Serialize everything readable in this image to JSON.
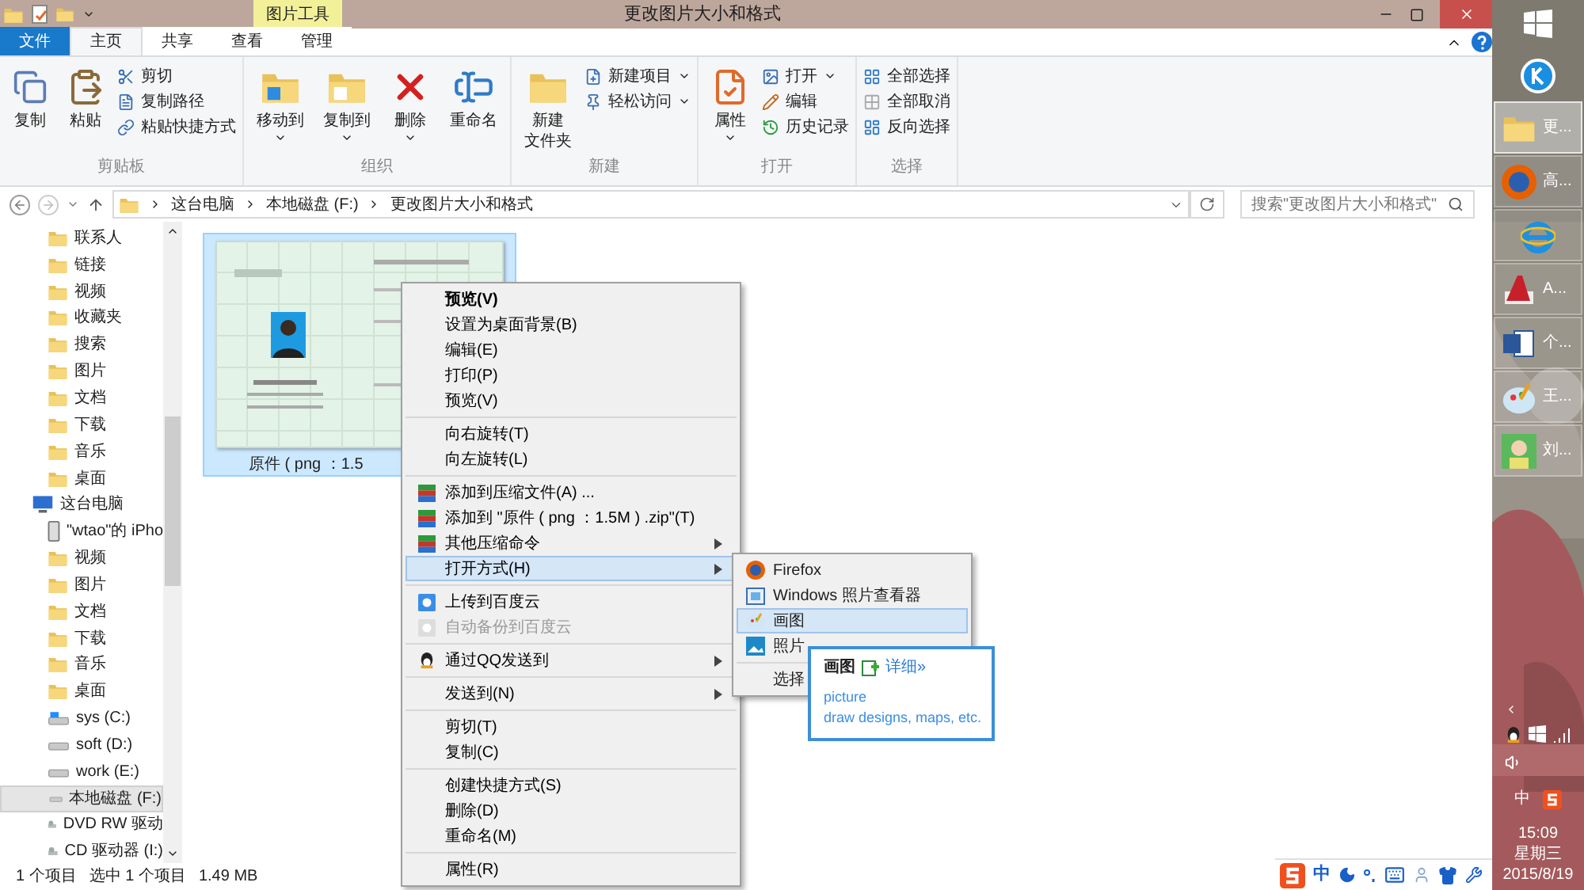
{
  "title_bar": {
    "context_tab": "图片工具",
    "title": "更改图片大小和格式"
  },
  "ribbon_tabs": [
    {
      "label": "文件",
      "kind": "file",
      "selected": false
    },
    {
      "label": "主页",
      "kind": "tab",
      "selected": true
    },
    {
      "label": "共享",
      "kind": "tab",
      "selected": false
    },
    {
      "label": "查看",
      "kind": "tab",
      "selected": false
    },
    {
      "label": "管理",
      "kind": "context",
      "selected": false
    }
  ],
  "ribbon_groups": [
    {
      "label": "剪贴板",
      "commands": [
        {
          "lines": [
            "复制"
          ],
          "kind": "large",
          "dropdown": false
        },
        {
          "lines": [
            "粘贴"
          ],
          "kind": "large",
          "dropdown": false
        },
        {
          "lines": [
            "剪切"
          ],
          "kind": "small",
          "dropdown": false
        },
        {
          "lines": [
            "复制路径"
          ],
          "kind": "small",
          "dropdown": false
        },
        {
          "lines": [
            "粘贴快捷方式"
          ],
          "kind": "small",
          "dropdown": false
        }
      ]
    },
    {
      "label": "组织",
      "commands": [
        {
          "lines": [
            "移动到"
          ],
          "kind": "large",
          "dropdown": true
        },
        {
          "lines": [
            "复制到"
          ],
          "kind": "large",
          "dropdown": true
        },
        {
          "lines": [
            "删除"
          ],
          "kind": "large",
          "dropdown": true
        },
        {
          "lines": [
            "重命名"
          ],
          "kind": "large",
          "dropdown": false
        }
      ]
    },
    {
      "label": "新建",
      "commands": [
        {
          "lines": [
            "新建",
            "文件夹"
          ],
          "kind": "large",
          "dropdown": false
        },
        {
          "lines": [
            "新建项目"
          ],
          "kind": "small",
          "dropdown": true
        },
        {
          "lines": [
            "轻松访问"
          ],
          "kind": "small",
          "dropdown": true
        }
      ]
    },
    {
      "label": "打开",
      "commands": [
        {
          "lines": [
            "属性"
          ],
          "kind": "large",
          "dropdown": true
        },
        {
          "lines": [
            "打开"
          ],
          "kind": "small",
          "dropdown": true
        },
        {
          "lines": [
            "编辑"
          ],
          "kind": "small",
          "dropdown": false
        },
        {
          "lines": [
            "历史记录"
          ],
          "kind": "small",
          "dropdown": false
        }
      ]
    },
    {
      "label": "选择",
      "commands": [
        {
          "lines": [
            "全部选择"
          ],
          "kind": "small",
          "dropdown": false
        },
        {
          "lines": [
            "全部取消"
          ],
          "kind": "small",
          "dropdown": false
        },
        {
          "lines": [
            "反向选择"
          ],
          "kind": "small",
          "dropdown": false
        }
      ]
    }
  ],
  "address_bar": {
    "crumbs": [
      "这台电脑",
      "本地磁盘 (F:)",
      "更改图片大小和格式"
    ],
    "search_placeholder": "搜索\"更改图片大小和格式\""
  },
  "nav_tree": [
    {
      "label": "联系人",
      "kind": "folder",
      "selected": false
    },
    {
      "label": "链接",
      "kind": "folder",
      "selected": false
    },
    {
      "label": "视频",
      "kind": "folder",
      "selected": false
    },
    {
      "label": "收藏夹",
      "kind": "folder",
      "selected": false
    },
    {
      "label": "搜索",
      "kind": "folder",
      "selected": false
    },
    {
      "label": "图片",
      "kind": "folder",
      "selected": false
    },
    {
      "label": "文档",
      "kind": "folder",
      "selected": false
    },
    {
      "label": "下载",
      "kind": "folder",
      "selected": false
    },
    {
      "label": "音乐",
      "kind": "folder",
      "selected": false
    },
    {
      "label": "桌面",
      "kind": "folder",
      "selected": false
    },
    {
      "label": "这台电脑",
      "kind": "pc",
      "selected": false,
      "children": [
        {
          "label": "\"wtao\"的 iPho",
          "kind": "phone",
          "selected": false
        },
        {
          "label": "视频",
          "kind": "folder",
          "selected": false
        },
        {
          "label": "图片",
          "kind": "folder",
          "selected": false
        },
        {
          "label": "文档",
          "kind": "folder",
          "selected": false
        },
        {
          "label": "下载",
          "kind": "folder",
          "selected": false
        },
        {
          "label": "音乐",
          "kind": "folder",
          "selected": false
        },
        {
          "label": "桌面",
          "kind": "folder",
          "selected": false
        },
        {
          "label": "sys (C:)",
          "kind": "system_drive",
          "selected": false
        },
        {
          "label": "soft (D:)",
          "kind": "drive",
          "selected": false
        },
        {
          "label": "work (E:)",
          "kind": "drive",
          "selected": false
        },
        {
          "label": "本地磁盘 (F:)",
          "kind": "drive",
          "selected": true
        },
        {
          "label": "DVD RW 驱动",
          "kind": "optical",
          "selected": false
        },
        {
          "label": "CD 驱动器 (I:)",
          "kind": "optical",
          "selected": false
        }
      ]
    }
  ],
  "files": [
    {
      "kind": "picture",
      "caption": "原件 ( png ：1.5",
      "selected": true
    }
  ],
  "status_bar": [
    "1 个项目",
    "选中 1 个项目",
    "1.49 MB"
  ],
  "context_menu": [
    [
      {
        "label": "预览(V)",
        "kind": "plain",
        "default": true,
        "submenu": false,
        "disabled": false,
        "selected": false
      },
      {
        "label": "设置为桌面背景(B)",
        "kind": "plain",
        "default": false,
        "submenu": false,
        "disabled": false,
        "selected": false
      },
      {
        "label": "编辑(E)",
        "kind": "plain",
        "default": false,
        "submenu": false,
        "disabled": false,
        "selected": false
      },
      {
        "label": "打印(P)",
        "kind": "plain",
        "default": false,
        "submenu": false,
        "disabled": false,
        "selected": false
      },
      {
        "label": "预览(V)",
        "kind": "plain",
        "default": false,
        "submenu": false,
        "disabled": false,
        "selected": false
      }
    ],
    [
      {
        "label": "向右旋转(T)",
        "kind": "plain",
        "default": false,
        "submenu": false,
        "disabled": false,
        "selected": false
      },
      {
        "label": "向左旋转(L)",
        "kind": "plain",
        "default": false,
        "submenu": false,
        "disabled": false,
        "selected": false
      }
    ],
    [
      {
        "label": "添加到压缩文件(A) ...",
        "kind": "archive",
        "default": false,
        "submenu": false,
        "disabled": false,
        "selected": false
      },
      {
        "label": "添加到 \"原件 ( png ：1.5M ) .zip\"(T)",
        "kind": "archive",
        "default": false,
        "submenu": false,
        "disabled": false,
        "selected": false
      },
      {
        "label": "其他压缩命令",
        "kind": "archive",
        "default": false,
        "submenu": true,
        "disabled": false,
        "selected": false
      },
      {
        "label": "打开方式(H)",
        "kind": "plain",
        "default": false,
        "submenu": true,
        "disabled": false,
        "selected": true
      }
    ],
    [
      {
        "label": "上传到百度云",
        "kind": "cloud",
        "default": false,
        "submenu": false,
        "disabled": false,
        "selected": false
      },
      {
        "label": "自动备份到百度云",
        "kind": "cloud",
        "default": false,
        "submenu": false,
        "disabled": true,
        "selected": false
      }
    ],
    [
      {
        "label": "通过QQ发送到",
        "kind": "qq",
        "default": false,
        "submenu": true,
        "disabled": false,
        "selected": false
      }
    ],
    [
      {
        "label": "发送到(N)",
        "kind": "plain",
        "default": false,
        "submenu": true,
        "disabled": false,
        "selected": false
      }
    ],
    [
      {
        "label": "剪切(T)",
        "kind": "plain",
        "default": false,
        "submenu": false,
        "disabled": false,
        "selected": false
      },
      {
        "label": "复制(C)",
        "kind": "plain",
        "default": false,
        "submenu": false,
        "disabled": false,
        "selected": false
      }
    ],
    [
      {
        "label": "创建快捷方式(S)",
        "kind": "plain",
        "default": false,
        "submenu": false,
        "disabled": false,
        "selected": false
      },
      {
        "label": "删除(D)",
        "kind": "plain",
        "default": false,
        "submenu": false,
        "disabled": false,
        "selected": false
      },
      {
        "label": "重命名(M)",
        "kind": "plain",
        "default": false,
        "submenu": false,
        "disabled": false,
        "selected": false
      }
    ],
    [
      {
        "label": "属性(R)",
        "kind": "plain",
        "default": false,
        "submenu": false,
        "disabled": false,
        "selected": false
      }
    ]
  ],
  "open_with_menu": [
    [
      {
        "label": "Firefox",
        "kind": "firefox",
        "selected": false
      },
      {
        "label": "Windows 照片查看器",
        "kind": "viewer",
        "selected": false
      },
      {
        "label": "画图",
        "kind": "paint",
        "selected": true
      },
      {
        "label": "照片",
        "kind": "photos",
        "selected": false
      }
    ],
    [
      {
        "label": "选择",
        "kind": "plain",
        "selected": false
      }
    ]
  ],
  "tooltip": {
    "title": "画图",
    "link": "详细»",
    "lines": [
      "picture",
      "draw designs, maps, etc."
    ]
  },
  "ime_bar": {
    "mode": "中"
  },
  "taskbar": {
    "buttons": [
      {
        "label": "更...",
        "selected": true
      },
      {
        "label": "高...",
        "selected": false
      },
      {
        "selected": false
      },
      {
        "label": "A...",
        "selected": false
      },
      {
        "label": "个...",
        "selected": false
      },
      {
        "label": "王...",
        "selected": false
      },
      {
        "label": "刘...",
        "selected": false
      }
    ],
    "tray_lang": "中",
    "time": "15:09",
    "weekday": "星期三",
    "date": "2015/8/19"
  }
}
